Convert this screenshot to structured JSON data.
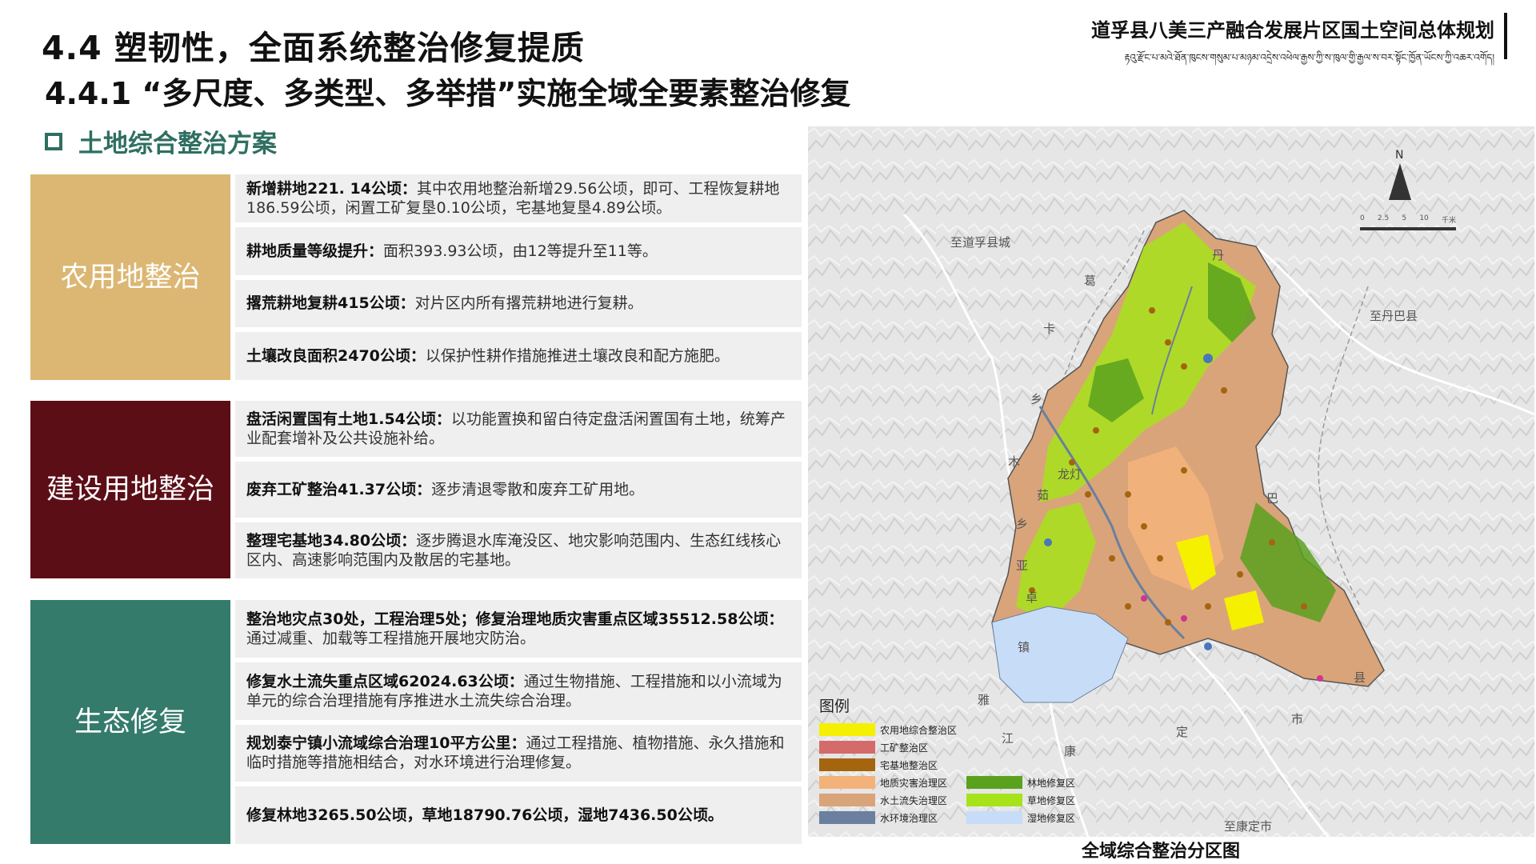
{
  "header": {
    "title": "4.4 塑韧性，全面系统整治修复提质",
    "subtitle": "4.4.1 “多尺度、多类型、多举措”实施全域全要素整治修复",
    "brand_cn": "道孚县八美三产融合发展片区国土空间总体规划",
    "brand_tib": "རྟའུ་རྫོང་པ་མའེ་ཐོན་ཁུངས་གསུམ་པ་མཉམ་འདྲེས་འཕེལ་རྒྱས་ཀྱི་ས་ཁུལ་གྱི་རྒྱལ་ས་བར་སྟོང་ཁྱོན་ཡོངས་ཀྱི་འཆར་འགོད།"
  },
  "section": {
    "label": "土地综合整治方案"
  },
  "groups": [
    {
      "label": "农用地整治",
      "color": "#dcb773",
      "items": [
        {
          "bold": "新增耕地221. 14公顷：",
          "text": "其中农用地整治新增29.56公顷，即可、工程恢复耕地186.59公顷，闲置工矿复垦0.10公顷，宅基地复垦4.89公顷。"
        },
        {
          "bold": "耕地质量等级提升：",
          "text": "面积393.93公顷，由12等提升至11等。"
        },
        {
          "bold": "撂荒耕地复耕415公顷：",
          "text": "对片区内所有撂荒耕地进行复耕。"
        },
        {
          "bold": "土壤改良面积2470公顷：",
          "text": "以保护性耕作措施推进土壤改良和配方施肥。"
        }
      ]
    },
    {
      "label": "建设用地整治",
      "color": "#5c0e17",
      "items": [
        {
          "bold": "盘活闲置国有土地1.54公顷：",
          "text": "以功能置换和留白待定盘活闲置国有土地，统筹产业配套增补及公共设施补给。"
        },
        {
          "bold": "废弃工矿整治41.37公顷：",
          "text": "逐步清退零散和废弃工矿用地。"
        },
        {
          "bold": "整理宅基地34.80公顷：",
          "text": "逐步腾退水库淹没区、地灾影响范围内、生态红线核心区内、高速影响范围内及散居的宅基地。"
        }
      ]
    },
    {
      "label": "生态修复",
      "color": "#347b6c",
      "items": [
        {
          "bold": "整治地灾点30处，工程治理5处；修复治理地质灾害重点区域35512.58公顷：",
          "text": "通过减重、加载等工程措施开展地灾防治。"
        },
        {
          "bold": "修复水土流失重点区域62024.63公顷：",
          "text": "通过生物措施、工程措施和以小流域为单元的综合治理措施有序推进水土流失综合治理。"
        },
        {
          "bold": "规划泰宁镇小流域综合治理10平方公里：",
          "text": "通过工程措施、植物措施、永久措施和临时措施等措施相结合，对水环境进行治理修复。"
        },
        {
          "bold": "修复林地3265.50公顷，草地18790.76公顷，湿地7436.50公顷。",
          "text": ""
        }
      ]
    }
  ],
  "map": {
    "caption": "全域综合整治分区图",
    "north": "N",
    "scale": [
      "0",
      "2.5",
      "5",
      "10"
    ],
    "scale_unit": "千米",
    "place_labels": [
      {
        "text": "至道孚县城"
      },
      {
        "text": "至丹巴县"
      },
      {
        "text": "至康定市"
      },
      {
        "text": "丹"
      },
      {
        "text": "葛"
      },
      {
        "text": "卡"
      },
      {
        "text": "乡"
      },
      {
        "text": "木"
      },
      {
        "text": "茹"
      },
      {
        "text": "乡"
      },
      {
        "text": "亚"
      },
      {
        "text": "卓"
      },
      {
        "text": "镇"
      },
      {
        "text": "巴"
      },
      {
        "text": "县"
      },
      {
        "text": "雅"
      },
      {
        "text": "江"
      },
      {
        "text": "康"
      },
      {
        "text": "定"
      },
      {
        "text": "市"
      },
      {
        "text": "龙灯"
      }
    ],
    "legend_title": "图例",
    "legend_col1": [
      {
        "label": "农用地综合整治区",
        "color": "#f5f000"
      },
      {
        "label": "工矿整治区",
        "color": "#d46a6a"
      },
      {
        "label": "宅基地整治区",
        "color": "#a5650f"
      },
      {
        "label": "地质灾害治理区",
        "color": "#f3b27a"
      },
      {
        "label": "水土流失治理区",
        "color": "#d9a47a"
      },
      {
        "label": "水环境治理区",
        "color": "#6b7f9e"
      }
    ],
    "legend_col2": [
      {
        "label": "林地修复区",
        "color": "#5aa11e"
      },
      {
        "label": "草地修复区",
        "color": "#a6e31b"
      },
      {
        "label": "湿地修复区",
        "color": "#c7dcf7"
      }
    ]
  }
}
